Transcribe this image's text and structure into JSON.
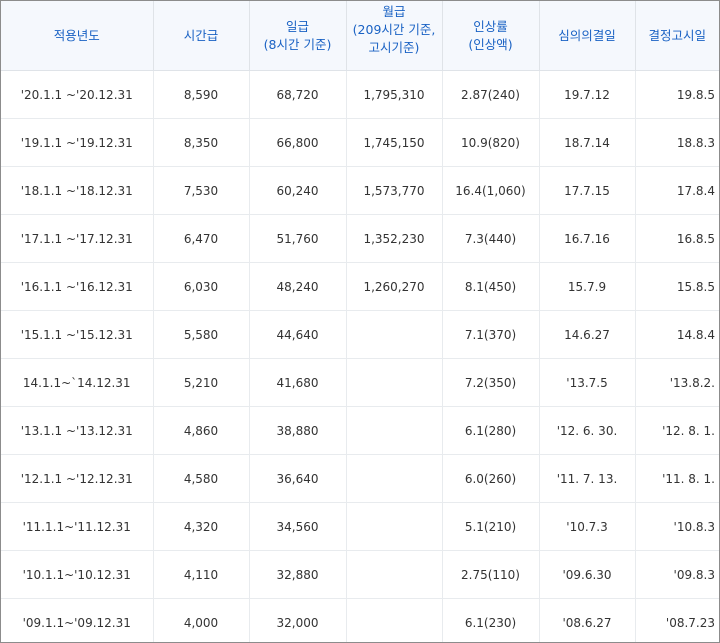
{
  "headers": [
    {
      "l1": "적용년도",
      "l2": ""
    },
    {
      "l1": "시간급",
      "l2": ""
    },
    {
      "l1": "일급",
      "l2": "(8시간 기준)"
    },
    {
      "l1": "월급",
      "l2": "(209시간 기준,",
      "l3": "고시기준)"
    },
    {
      "l1": "인상률",
      "l2": "(인상액)"
    },
    {
      "l1": "심의의결일",
      "l2": ""
    },
    {
      "l1": "결정고시일",
      "l2": ""
    }
  ],
  "rows": [
    {
      "period": "'20.1.1 ~'20.12.31",
      "hourly": "8,590",
      "daily": "68,720",
      "monthly": "1,795,310",
      "rate": "2.87(240)",
      "decision": "19.7.12",
      "notice": "19.8.5"
    },
    {
      "period": "'19.1.1 ~'19.12.31",
      "hourly": "8,350",
      "daily": "66,800",
      "monthly": "1,745,150",
      "rate": "10.9(820)",
      "decision": "18.7.14",
      "notice": "18.8.3"
    },
    {
      "period": "'18.1.1 ~'18.12.31",
      "hourly": "7,530",
      "daily": "60,240",
      "monthly": "1,573,770",
      "rate": "16.4(1,060)",
      "decision": "17.7.15",
      "notice": "17.8.4"
    },
    {
      "period": "'17.1.1 ~'17.12.31",
      "hourly": "6,470",
      "daily": "51,760",
      "monthly": "1,352,230",
      "rate": "7.3(440)",
      "decision": "16.7.16",
      "notice": "16.8.5"
    },
    {
      "period": "'16.1.1 ~'16.12.31",
      "hourly": "6,030",
      "daily": "48,240",
      "monthly": "1,260,270",
      "rate": "8.1(450)",
      "decision": "15.7.9",
      "notice": "15.8.5"
    },
    {
      "period": "'15.1.1 ~'15.12.31",
      "hourly": "5,580",
      "daily": "44,640",
      "monthly": "",
      "rate": "7.1(370)",
      "decision": "14.6.27",
      "notice": "14.8.4"
    },
    {
      "period": "14.1.1~`14.12.31",
      "hourly": "5,210",
      "daily": "41,680",
      "monthly": "",
      "rate": "7.2(350)",
      "decision": "'13.7.5",
      "notice": "'13.8.2."
    },
    {
      "period": "'13.1.1 ~'13.12.31",
      "hourly": "4,860",
      "daily": "38,880",
      "monthly": "",
      "rate": "6.1(280)",
      "decision": "'12. 6. 30.",
      "notice": "'12. 8. 1."
    },
    {
      "period": "'12.1.1 ~'12.12.31",
      "hourly": "4,580",
      "daily": "36,640",
      "monthly": "",
      "rate": "6.0(260)",
      "decision": "'11. 7. 13.",
      "notice": "'11. 8. 1."
    },
    {
      "period": "'11.1.1~'11.12.31",
      "hourly": "4,320",
      "daily": "34,560",
      "monthly": "",
      "rate": "5.1(210)",
      "decision": "'10.7.3",
      "notice": "'10.8.3"
    },
    {
      "period": "'10.1.1~'10.12.31",
      "hourly": "4,110",
      "daily": "32,880",
      "monthly": "",
      "rate": "2.75(110)",
      "decision": "'09.6.30",
      "notice": "'09.8.3"
    },
    {
      "period": "'09.1.1~'09.12.31",
      "hourly": "4,000",
      "daily": "32,000",
      "monthly": "",
      "rate": "6.1(230)",
      "decision": "'08.6.27",
      "notice": "'08.7.23"
    }
  ]
}
